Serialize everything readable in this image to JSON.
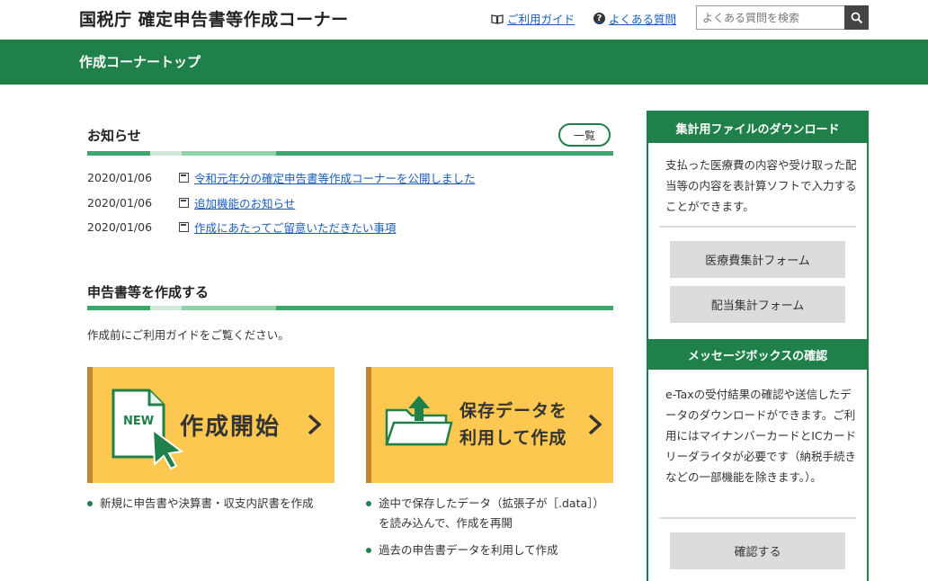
{
  "header": {
    "site_title": "国税庁 確定申告書等作成コーナー",
    "guide_link": "ご利用ガイド",
    "faq_link": "よくある質問",
    "search_placeholder": "よくある質問を検索"
  },
  "band": {
    "title": "作成コーナートップ"
  },
  "news": {
    "title": "お知らせ",
    "list_button": "一覧",
    "items": [
      {
        "date": "2020/01/06",
        "text": "令和元年分の確定申告書等作成コーナーを公開しました"
      },
      {
        "date": "2020/01/06",
        "text": "追加機能のお知らせ"
      },
      {
        "date": "2020/01/06",
        "text": "作成にあたってご留意いただきたい事項"
      }
    ]
  },
  "create": {
    "title": "申告書等を作成する",
    "intro": "作成前にご利用ガイドをご覧ください。",
    "start_card": {
      "badge": "NEW",
      "label": "作成開始",
      "bullet": "新規に申告書や決算書・収支内訳書を作成"
    },
    "saved_card": {
      "label_line1": "保存データを",
      "label_line2": "利用して作成",
      "bullet1_line1": "途中で保存したデータ（拡張子が［.data］）",
      "bullet1_line2": "を読み込んで、作成を再開",
      "bullet2": "過去の申告書データを利用して作成"
    }
  },
  "side": {
    "download": {
      "title": "集計用ファイルのダウンロード",
      "text": "支払った医療費の内容や受け取った配当等の内容を表計算ソフトで入力することができます。",
      "button1": "医療費集計フォーム",
      "button2": "配当集計フォーム"
    },
    "messagebox": {
      "title": "メッセージボックスの確認",
      "text": "e-Taxの受付結果の確認や送信したデータのダウンロードができます。ご利用にはマイナンバーカードとICカードリーダライタが必要です（納税手続きなどの一部機能を除きます。）。",
      "button": "確認する"
    }
  },
  "colors": {
    "brand_green": "#208049",
    "card_yellow": "#fcc84f",
    "link_blue": "#1a5ebd"
  }
}
